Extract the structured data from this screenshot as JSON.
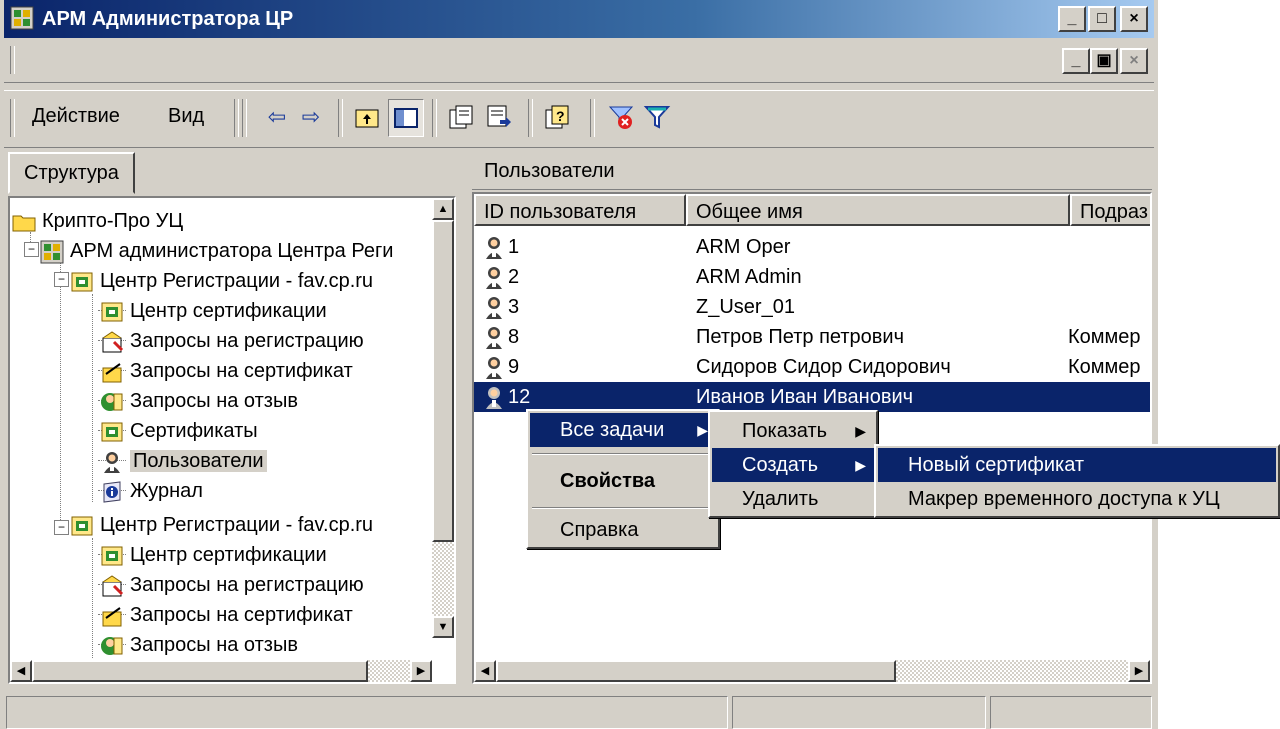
{
  "window": {
    "title": "АРМ Администратора ЦР"
  },
  "caption_buttons": {
    "minimize": "_",
    "maximize": "□",
    "close": "×",
    "restore": "▣"
  },
  "toolbar": {
    "menu_action": "Действие",
    "menu_view": "Вид",
    "back_glyph": "⇦",
    "forward_glyph": "⇨"
  },
  "left_tab": {
    "label": "Структура"
  },
  "tree": [
    {
      "label": "Крипто-Про УЦ",
      "icon": "folder-icon"
    },
    {
      "label": "АРМ администратора Центра Реги",
      "icon": "console-icon"
    },
    {
      "label": "Центр Регистрации - fav.cp.ru",
      "icon": "registration-center-icon"
    },
    {
      "label": "Центр сертификации",
      "icon": "certification-center-icon"
    },
    {
      "label": "Запросы на регистрацию",
      "icon": "registration-requests-icon"
    },
    {
      "label": "Запросы на сертификат",
      "icon": "certificate-requests-icon"
    },
    {
      "label": "Запросы на отзыв",
      "icon": "revocation-requests-icon"
    },
    {
      "label": "Сертификаты",
      "icon": "certificates-icon"
    },
    {
      "label": "Пользователи",
      "icon": "users-icon"
    },
    {
      "label": "Журнал",
      "icon": "log-icon"
    },
    {
      "label": "Центр Регистрации - fav.cp.ru",
      "icon": "registration-center-icon"
    },
    {
      "label": "Центр сертификации",
      "icon": "certification-center-icon"
    },
    {
      "label": "Запросы на регистрацию",
      "icon": "registration-requests-icon"
    },
    {
      "label": "Запросы на сертификат",
      "icon": "certificate-requests-icon"
    },
    {
      "label": "Запросы на отзыв",
      "icon": "revocation-requests-icon"
    }
  ],
  "right_pane": {
    "title": "Пользователи",
    "columns": [
      "ID пользователя",
      "Общее имя",
      "Подраз"
    ],
    "rows": [
      {
        "id": "1",
        "name": "ARM Oper",
        "dept": ""
      },
      {
        "id": "2",
        "name": "ARM Admin",
        "dept": ""
      },
      {
        "id": "3",
        "name": "Z_User_01",
        "dept": ""
      },
      {
        "id": "8",
        "name": "Петров Петр петрович",
        "dept": "Коммер"
      },
      {
        "id": "9",
        "name": "Сидоров Сидор Сидорович",
        "dept": "Коммер"
      },
      {
        "id": "12",
        "name": "Иванов Иван Иванович",
        "dept": ""
      }
    ],
    "selected_row_id": "12"
  },
  "context_menu": {
    "all_tasks": "Все задачи",
    "properties": "Свойства",
    "help": "Справка"
  },
  "submenu_tasks": {
    "show": "Показать",
    "create": "Создать",
    "delete": "Удалить"
  },
  "submenu_create": {
    "new_certificate": "Новый сертификат",
    "access_token": "Макрер временного доступа к УЦ"
  },
  "colors": {
    "selection": "#0a246a",
    "face": "#d4d0c8"
  }
}
